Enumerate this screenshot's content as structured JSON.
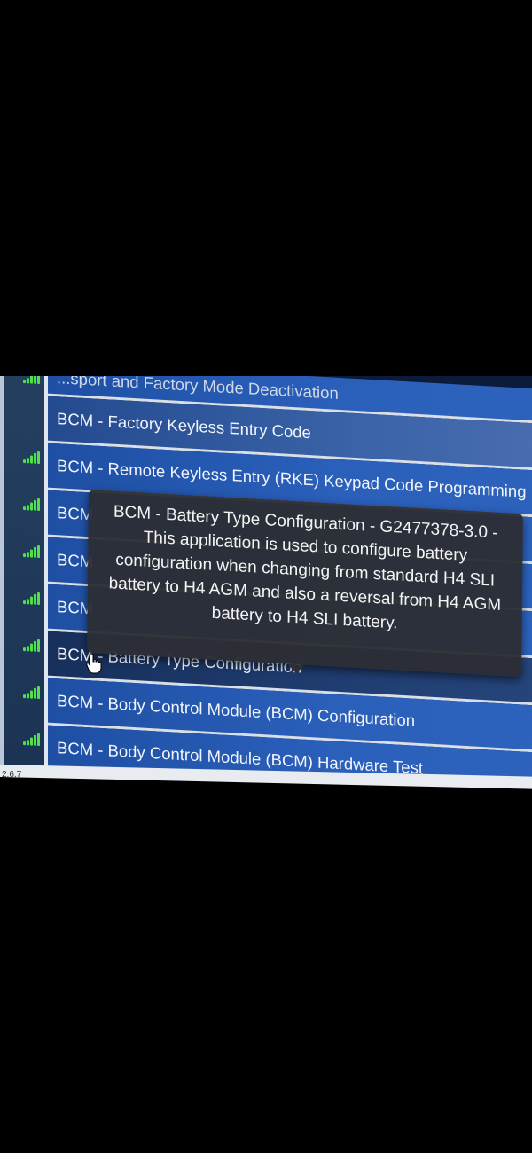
{
  "rows": [
    {
      "label": "...sport and Factory Mode Deactivation",
      "signal": true
    },
    {
      "label": "BCM - Factory Keyless Entry Code",
      "signal": false
    },
    {
      "label": "BCM - Remote Keyless Entry (RKE) Keypad Code Programming",
      "signal": true
    },
    {
      "label": "BCM",
      "signal": true
    },
    {
      "label": "BCM",
      "signal": true
    },
    {
      "label": "BCM",
      "signal": true
    },
    {
      "label": "BCM - Battery Type Configuration",
      "signal": true
    },
    {
      "label": "BCM - Body Control Module (BCM) Configuration",
      "signal": true
    },
    {
      "label": "BCM - Body Control Module (BCM) Hardware Test",
      "signal": true
    }
  ],
  "tooltip": {
    "lines": [
      "BCM - Battery Type Configuration - G2477378-3.0 -",
      "This application is used to configure battery",
      "configuration when changing from standard H4 SLI",
      "battery to H4 AGM and also a reversal from H4 AGM",
      "battery to H4 SLI battery."
    ]
  },
  "footer": {
    "page_num": "2.6.7"
  },
  "colors": {
    "signal": "#4fe04a",
    "row_blue": "#2a5fba",
    "tooltip_bg": "#2c2e34"
  }
}
